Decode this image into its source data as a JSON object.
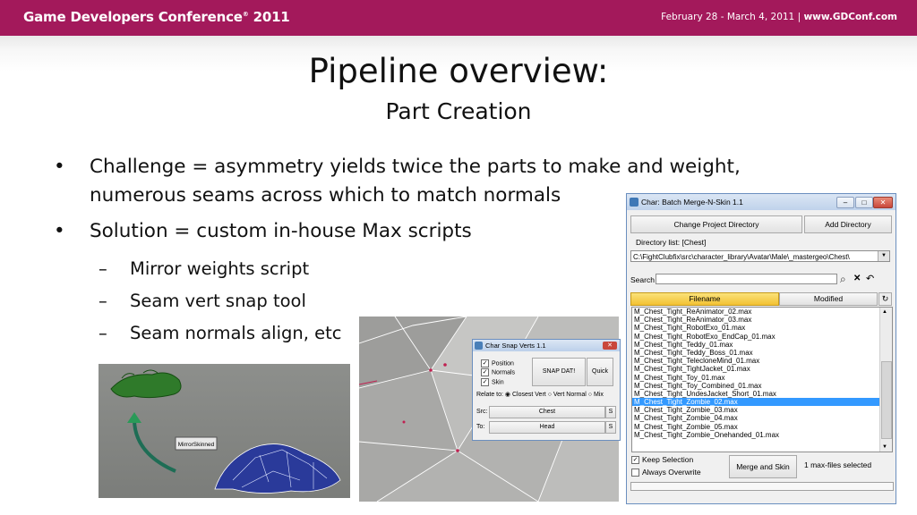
{
  "header": {
    "conference": "Game Developers Conference",
    "conference_reg": "®",
    "year": "2011",
    "dates": "February 28 - March 4, 2011",
    "separator": "|",
    "url": "www.GDConf.com",
    "banner_color": "#a3195b"
  },
  "slide": {
    "title": "Pipeline overview:",
    "subtitle": "Part Creation",
    "bullets": [
      {
        "marker": "•",
        "text_line1": "Challenge = asymmetry yields twice the parts to make and weight,",
        "text_line2": "numerous seams across which to match normals"
      },
      {
        "marker": "•",
        "text": "Solution = custom in-house Max scripts"
      }
    ],
    "sub_bullets": [
      {
        "marker": "–",
        "text": "Mirror weights script"
      },
      {
        "marker": "–",
        "text": "Seam vert snap tool"
      },
      {
        "marker": "–",
        "text": "Seam normals align, etc"
      }
    ]
  },
  "mirror_image": {
    "label": "MirrorSkinned"
  },
  "snap_dialog": {
    "title": "Char Snap Verts 1.1",
    "close_icon": "close-icon",
    "checks": [
      {
        "label": "Position",
        "checked": true
      },
      {
        "label": "Normals",
        "checked": true
      },
      {
        "label": "Skin",
        "checked": true
      }
    ],
    "snap_button": "SNAP DAT!",
    "quick_button": "Quick",
    "relate_label": "Relate to:",
    "radio_options": [
      {
        "label": "Closest Vert",
        "selected": true
      },
      {
        "label": "Vert Normal",
        "selected": false
      },
      {
        "label": "Mix",
        "selected": false
      }
    ],
    "src_label": "Src:",
    "src_value": "Chest",
    "to_label": "To:",
    "to_value": "Head",
    "s_button": "S"
  },
  "batch_dialog": {
    "title": "Char: Batch Merge-N-Skin 1.1",
    "change_dir_button": "Change Project Directory",
    "add_dir_button": "Add Directory",
    "dir_list_label": "Directory list: [Chest]",
    "dir_path": "C:\\FightClubfix\\src\\character_library\\Avatar\\Male\\_mastergeo\\Chest\\",
    "search_label": "Search",
    "search_value": "",
    "col_filename": "Filename",
    "col_modified": "Modified",
    "files": [
      "M_Chest_Tight_ReAnimator_02.max",
      "M_Chest_Tight_ReAnimator_03.max",
      "M_Chest_Tight_RobotExo_01.max",
      "M_Chest_Tight_RobotExo_EndCap_01.max",
      "M_Chest_Tight_Teddy_01.max",
      "M_Chest_Tight_Teddy_Boss_01.max",
      "M_Chest_Tight_TelecloneMind_01.max",
      "M_Chest_Tight_TightJacket_01.max",
      "M_Chest_Tight_Toy_01.max",
      "M_Chest_Tight_Toy_Combined_01.max",
      "M_Chest_Tight_UndesJacket_Short_01.max",
      "M_Chest_Tight_Zombie_02.max",
      "M_Chest_Tight_Zombie_03.max",
      "M_Chest_Tight_Zombie_04.max",
      "M_Chest_Tight_Zombie_05.max",
      "M_Chest_Tight_Zombie_Onehanded_01.max"
    ],
    "selected_index": 11,
    "keep_selection_label": "Keep Selection",
    "keep_selection_checked": true,
    "always_overwrite_label": "Always Overwrite",
    "always_overwrite_checked": false,
    "merge_button": "Merge and Skin",
    "status": "1 max-files selected"
  }
}
